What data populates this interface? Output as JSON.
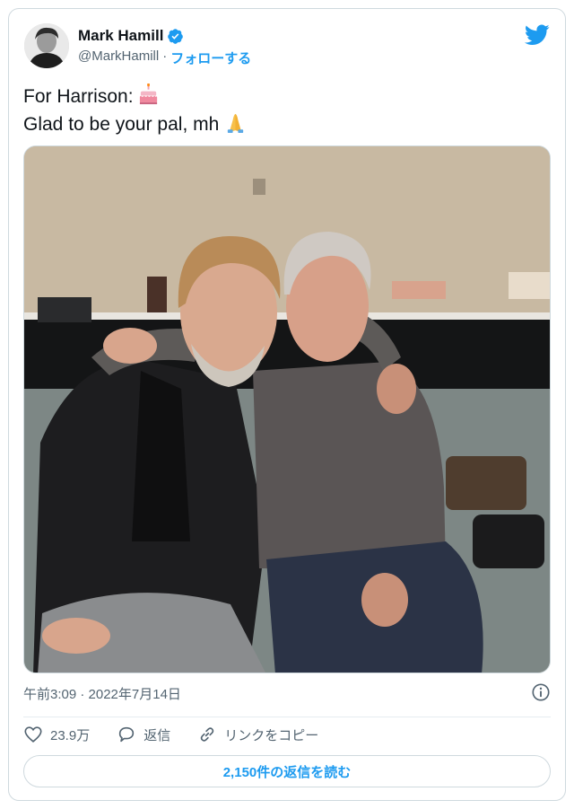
{
  "author": {
    "display_name": "Mark Hamill",
    "handle": "@MarkHamill",
    "separator": "·",
    "follow_label": "フォローする"
  },
  "tweet": {
    "line1": "For Harrison:",
    "line2": "Glad to be your pal, mh"
  },
  "meta": {
    "timestamp": "午前3:09 · 2022年7月14日"
  },
  "actions": {
    "likes": "23.9万",
    "reply": "返信",
    "copy_link": "リンクをコピー"
  },
  "read_replies_label": "2,150件の返信を読む",
  "colors": {
    "accent": "#1d9bf0",
    "text": "#0f1419",
    "secondary": "#536471",
    "border": "#cfd9de"
  },
  "icons": {
    "brand": "twitter-bird-icon",
    "verified": "verified-badge-icon",
    "emoji1": "birthday-cake-emoji",
    "emoji2": "folded-hands-emoji",
    "info": "info-icon",
    "like": "heart-icon",
    "reply": "speech-bubble-icon",
    "link": "link-icon"
  }
}
